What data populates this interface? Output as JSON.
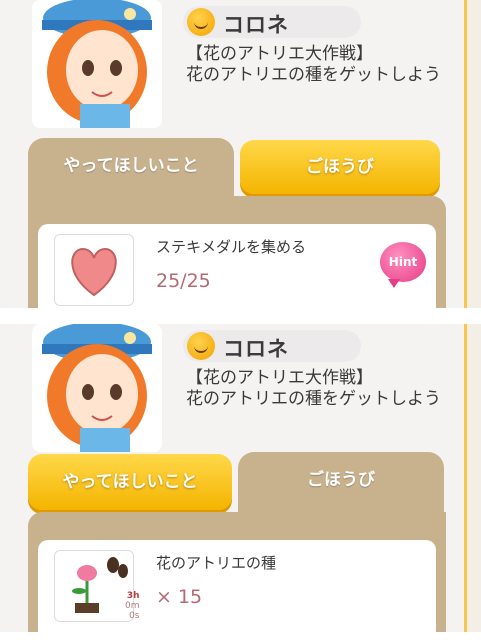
{
  "panels": [
    {
      "character_name": "コロネ",
      "mission_title": "【花のアトリエ大作戦】",
      "mission_desc": "花のアトリエの種をゲットしよう",
      "tab_tasks": "やってほしいこと",
      "tab_rewards": "ごほうび",
      "active_tab": "rewards",
      "item_name": "ステキメダルを集める",
      "item_value": "25/25",
      "hint_label": "Hint"
    },
    {
      "character_name": "コロネ",
      "mission_title": "【花のアトリエ大作戦】",
      "mission_desc": "花のアトリエの種をゲットしよう",
      "tab_tasks": "やってほしいこと",
      "tab_rewards": "ごほうび",
      "active_tab": "tasks",
      "item_name": "花のアトリエの種",
      "item_value": "× 15",
      "time_h": "3h",
      "time_m": "0m",
      "time_s": "0s"
    }
  ],
  "colors": {
    "tab_brown": "#c8b28e",
    "tab_yellow": "#f4b400",
    "count_text": "#b46a73",
    "hint_pink": "#e63b86"
  }
}
